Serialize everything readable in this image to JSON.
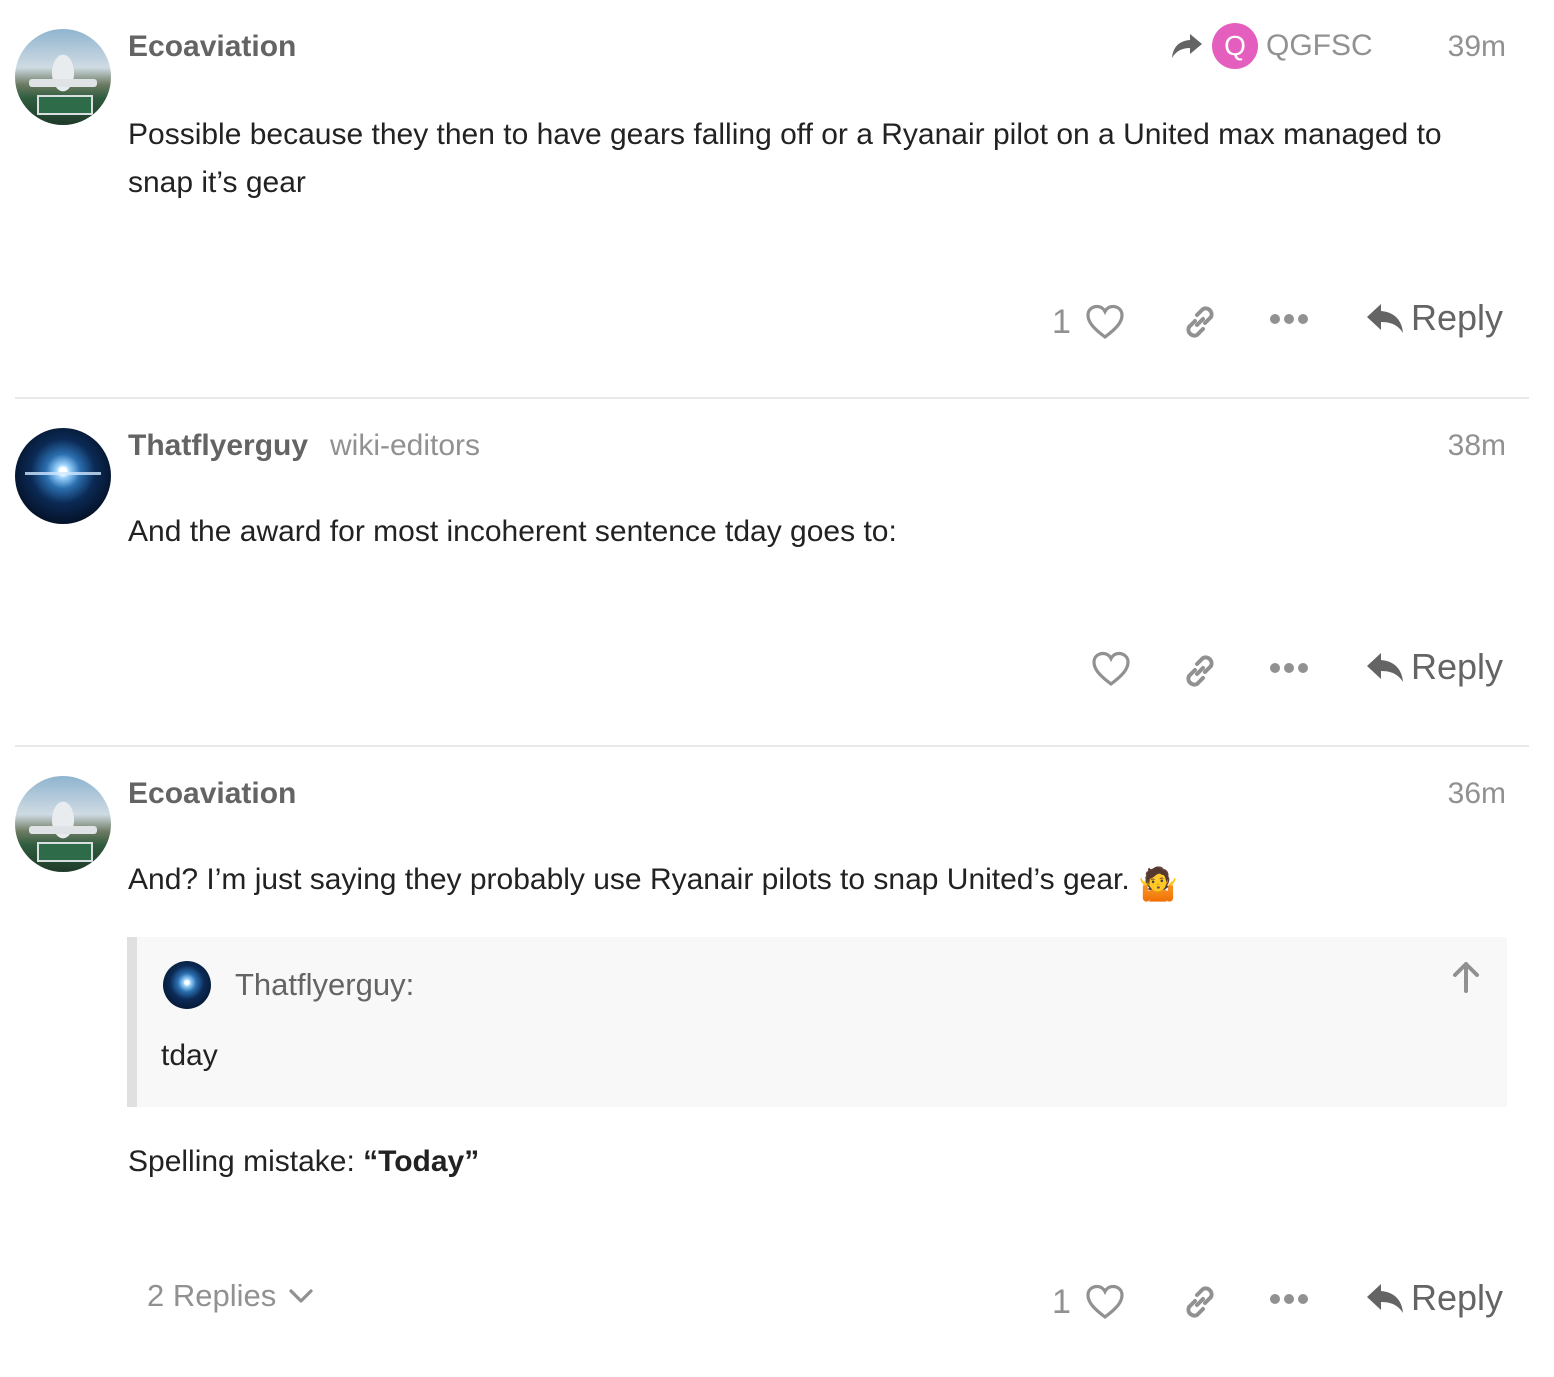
{
  "posts": [
    {
      "username": "Ecoaviation",
      "reply_to": {
        "avatar_letter": "Q",
        "name": "QGFSC"
      },
      "time": "39m",
      "body": "Possible because they then to have gears falling off or a Ryanair pilot on a United max managed to snap it’s gear",
      "like_count": "1",
      "reply_label": "Reply"
    },
    {
      "username": "Thatflyerguy",
      "group": "wiki-editors",
      "time": "38m",
      "body": "And the award for most incoherent sentence tday goes to:",
      "reply_label": "Reply"
    },
    {
      "username": "Ecoaviation",
      "time": "36m",
      "body": "And? I’m just saying they probably use Ryanair pilots to snap United’s gear.",
      "emoji": "🤷",
      "quote": {
        "user": "Thatflyerguy:",
        "text": "tday"
      },
      "after_quote_prefix": "Spelling mistake: ",
      "after_quote_bold": "“Today”",
      "replies_toggle": "2 Replies",
      "like_count": "1",
      "reply_label": "Reply"
    }
  ],
  "colors": {
    "muted": "#919191",
    "username": "#646464",
    "body": "#222222",
    "reply_avatar": "#e45fbd"
  },
  "icons": [
    "share-arrow-icon",
    "heart-icon",
    "link-icon",
    "more-icon",
    "reply-icon",
    "arrow-up-icon",
    "chevron-down-icon"
  ]
}
